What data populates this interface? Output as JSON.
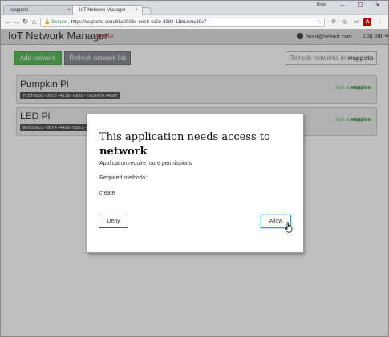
{
  "browser": {
    "tabs": [
      {
        "label": "wappsto",
        "active": false
      },
      {
        "label": "IoT Network Manager",
        "active": true
      }
    ],
    "profile_name": "Brian",
    "window_controls": {
      "minimize": "–",
      "maximize": "☐",
      "close": "✕"
    },
    "tab_close": "×",
    "nav": {
      "back": "←",
      "forward": "→",
      "reload": "↻",
      "home": "⌂"
    },
    "address": {
      "secure_label": "Secure",
      "url": "https://wappsto.com/81e2003e-eeeb-4a0e-8983-11b6ae6c39c7"
    },
    "icons": {
      "star": "☆",
      "lock": "🔒",
      "ext1": "⚙",
      "ext2": "◎",
      "ext3": "▭",
      "adobe": "A",
      "menu": "⋮"
    }
  },
  "app": {
    "title": "IoT Network Manager",
    "subtitle": "Apida",
    "user_email": "brian@seluxit.com",
    "logout_label": "Log out",
    "logout_icon": "⇥",
    "add_network_label": "Add network",
    "refresh_list_label": "Refresh network list",
    "refresh_wappsto_prefix": "Refresh networks in ",
    "refresh_wappsto_brand": "wappsto",
    "networks": [
      {
        "name": "Pumpkin Pi",
        "id": "fcbfed3c-bcc7-413b-995b-f929e7974a0f",
        "add_prefix": "Add to ",
        "add_brand": "wappsto"
      },
      {
        "name": "LED Pi",
        "id": "86055e23-ebf4-4466-b6d3-6ea",
        "add_prefix": "Add to ",
        "add_brand": "wappsto"
      }
    ]
  },
  "dialog": {
    "title_line1": "This application needs access to",
    "title_line2": "network",
    "description": "Application require more permissions",
    "required_label": "Required methods:",
    "method": "create",
    "deny_label": "Deny",
    "allow_label": "Allow"
  },
  "colors": {
    "primary_green": "#5cb85c",
    "allow_border": "#2aa3c9",
    "overlay": "rgba(0,0,0,0.25)"
  }
}
